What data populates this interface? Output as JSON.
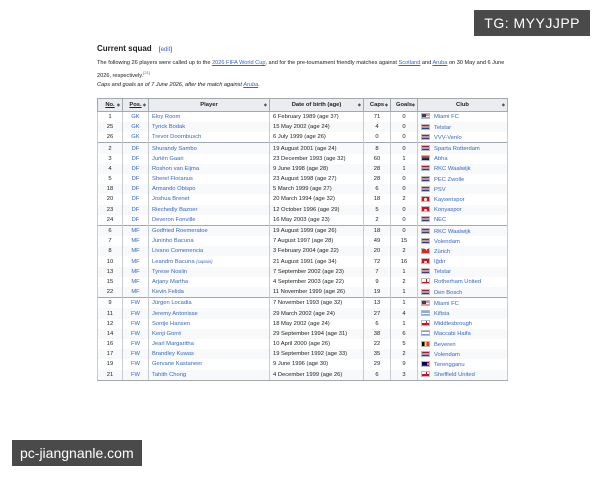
{
  "watermark_top": "TG: MYYJJPP",
  "watermark_bottom": "pc-jiangnanle.com",
  "section": {
    "heading": "Current squad",
    "edit_open": "[",
    "edit_label": "edit",
    "edit_close": "]"
  },
  "intro": {
    "p1": "The following 26 players were called up to the ",
    "link_world_cup": "2026 FIFA World Cup",
    "p2": ", and for the pre-tournament friendly matches against ",
    "link_scotland": "Scotland",
    "p3": " and ",
    "link_aruba": "Aruba",
    "p4": " on 30 May and 6 June 2026, respectively.",
    "ref": "[21]",
    "caps_note_1": "Caps and goals as of 7 June 2026, after the match against ",
    "caps_note_link": "Aruba",
    "caps_note_2": "."
  },
  "table": {
    "headers": {
      "no": "No.",
      "pos": "Pos.",
      "player": "Player",
      "dob": "Date of birth (age)",
      "caps": "Caps",
      "goals": "Goals",
      "club": "Club"
    },
    "sort_icon": "sort-icon",
    "rows": [
      {
        "no": "1",
        "pos": "GK",
        "player": "Eloy Room",
        "dob": "6 February 1989 (age 37)",
        "caps": "71",
        "goals": "0",
        "flag": "us",
        "club": "Miami FC"
      },
      {
        "no": "25",
        "pos": "GK",
        "player": "Tyrick Bodak",
        "dob": "15 May 2002 (age 24)",
        "caps": "4",
        "goals": "0",
        "flag": "nl",
        "club": "Telstar"
      },
      {
        "no": "26",
        "pos": "GK",
        "player": "Trevor Doornbusch",
        "dob": "6 July 1999 (age 26)",
        "caps": "0",
        "goals": "0",
        "flag": "nl",
        "club": "VVV-Venlo"
      },
      {
        "no": "2",
        "pos": "DF",
        "player": "Shurandy Sambo",
        "dob": "19 August 2001 (age 24)",
        "caps": "8",
        "goals": "0",
        "flag": "nl",
        "club": "Sparta Rotterdam"
      },
      {
        "no": "3",
        "pos": "DF",
        "player": "Juriën Gaari",
        "dob": "23 December 1993 (age 32)",
        "caps": "60",
        "goals": "1",
        "flag": "za",
        "club": "Abha"
      },
      {
        "no": "4",
        "pos": "DF",
        "player": "Roshon van Eijma",
        "dob": "9 June 1998 (age 28)",
        "caps": "28",
        "goals": "1",
        "flag": "nl",
        "club": "RKC Waalwijk"
      },
      {
        "no": "5",
        "pos": "DF",
        "player": "Sherel Floranus",
        "dob": "23 August 1998 (age 27)",
        "caps": "28",
        "goals": "0",
        "flag": "nl",
        "club": "PEC Zwolle"
      },
      {
        "no": "18",
        "pos": "DF",
        "player": "Armando Obispo",
        "dob": "5 March 1999 (age 27)",
        "caps": "6",
        "goals": "0",
        "flag": "nl",
        "club": "PSV"
      },
      {
        "no": "20",
        "pos": "DF",
        "player": "Joshua Brenet",
        "dob": "20 March 1994 (age 32)",
        "caps": "18",
        "goals": "2",
        "flag": "tr",
        "club": "Kayserispor"
      },
      {
        "no": "23",
        "pos": "DF",
        "player": "Riechedly Bazoer",
        "dob": "12 October 1996 (age 29)",
        "caps": "5",
        "goals": "0",
        "flag": "tr",
        "club": "Konyaspor"
      },
      {
        "no": "24",
        "pos": "DF",
        "player": "Deveron Fonville",
        "dob": "16 May 2003 (age 23)",
        "caps": "2",
        "goals": "0",
        "flag": "nl",
        "club": "NEC"
      },
      {
        "no": "6",
        "pos": "MF",
        "player": "Godfried Roemeratoe",
        "dob": "19 August 1999 (age 26)",
        "caps": "18",
        "goals": "0",
        "flag": "nl",
        "club": "RKC Waalwijk"
      },
      {
        "no": "7",
        "pos": "MF",
        "player": "Juninho Bacuna",
        "dob": "7 August 1997 (age 28)",
        "caps": "49",
        "goals": "15",
        "flag": "nl",
        "club": "Volendam"
      },
      {
        "no": "8",
        "pos": "MF",
        "player": "Livano Comenencia",
        "dob": "3 February 2004 (age 22)",
        "caps": "20",
        "goals": "2",
        "flag": "ch",
        "club": "Zürich"
      },
      {
        "no": "10",
        "pos": "MF",
        "player": "Leandro Bacuna",
        "captain": "(captain)",
        "dob": "21 August 1991 (age 34)",
        "caps": "72",
        "goals": "16",
        "flag": "tr",
        "club": "Iğdır"
      },
      {
        "no": "13",
        "pos": "MF",
        "player": "Tyrese Noslin",
        "dob": "7 September 2002 (age 23)",
        "caps": "7",
        "goals": "1",
        "flag": "nl",
        "club": "Telstar"
      },
      {
        "no": "15",
        "pos": "MF",
        "player": "Arjany Martha",
        "dob": "4 September 2003 (age 22)",
        "caps": "9",
        "goals": "2",
        "flag": "en",
        "club": "Rotherham United"
      },
      {
        "no": "22",
        "pos": "MF",
        "player": "Kevin Felida",
        "dob": "11 November 1999 (age 26)",
        "caps": "19",
        "goals": "1",
        "flag": "nl",
        "club": "Den Bosch"
      },
      {
        "no": "9",
        "pos": "FW",
        "player": "Jürgen Locadia",
        "dob": "7 November 1993 (age 32)",
        "caps": "13",
        "goals": "1",
        "flag": "us",
        "club": "Miami FC"
      },
      {
        "no": "11",
        "pos": "FW",
        "player": "Jeremy Antonisse",
        "dob": "29 March 2002 (age 24)",
        "caps": "27",
        "goals": "4",
        "flag": "gr",
        "club": "Kifisia"
      },
      {
        "no": "12",
        "pos": "FW",
        "player": "Sontje Hansen",
        "dob": "18 May 2002 (age 24)",
        "caps": "6",
        "goals": "1",
        "flag": "en",
        "club": "Middlesbrough"
      },
      {
        "no": "14",
        "pos": "FW",
        "player": "Kenji Gorré",
        "dob": "29 September 1994 (age 31)",
        "caps": "38",
        "goals": "6",
        "flag": "il",
        "club": "Maccabi Haifa"
      },
      {
        "no": "16",
        "pos": "FW",
        "player": "Jearl Margaritha",
        "dob": "10 April 2000 (age 26)",
        "caps": "22",
        "goals": "5",
        "flag": "be",
        "club": "Beveren"
      },
      {
        "no": "17",
        "pos": "FW",
        "player": "Brandley Kuwas",
        "dob": "19 September 1992 (age 33)",
        "caps": "35",
        "goals": "2",
        "flag": "nl",
        "club": "Volendam"
      },
      {
        "no": "19",
        "pos": "FW",
        "player": "Gervane Kastaneer",
        "dob": "9 June 1996 (age 30)",
        "caps": "29",
        "goals": "9",
        "flag": "my",
        "club": "Terengganu"
      },
      {
        "no": "21",
        "pos": "FW",
        "player": "Tahith Chong",
        "dob": "4 December 1999 (age 26)",
        "caps": "6",
        "goals": "3",
        "flag": "en",
        "club": "Sheffield United"
      }
    ]
  }
}
